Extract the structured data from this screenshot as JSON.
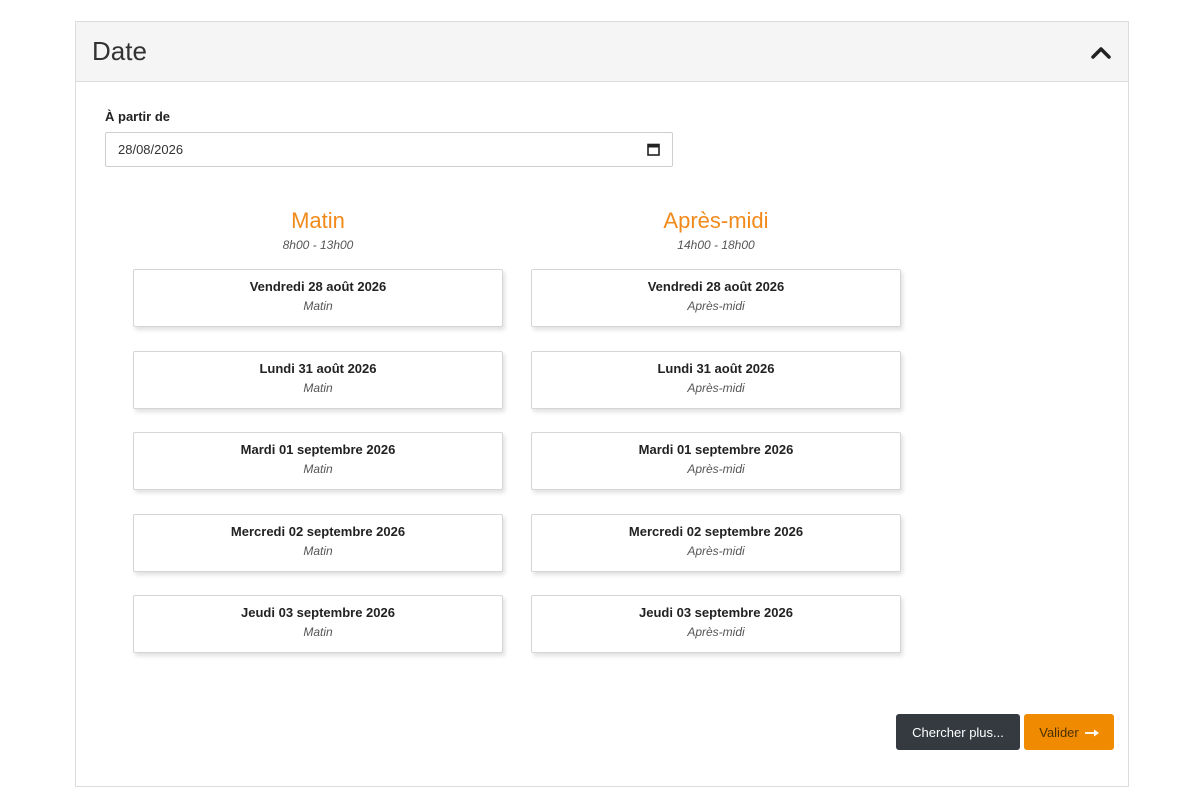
{
  "panel": {
    "title": "Date",
    "collapse_icon": "chevron-up-icon"
  },
  "start": {
    "label": "À partir de",
    "value": "28/08/2026",
    "icon": "calendar-icon"
  },
  "columns": [
    {
      "title": "Matin",
      "hours": "8h00 - 13h00",
      "slots": [
        {
          "date": "Vendredi 28 août 2026",
          "period": "Matin"
        },
        {
          "date": "Lundi 31 août 2026",
          "period": "Matin"
        },
        {
          "date": "Mardi 01 septembre 2026",
          "period": "Matin"
        },
        {
          "date": "Mercredi 02 septembre 2026",
          "period": "Matin"
        },
        {
          "date": "Jeudi 03 septembre 2026",
          "period": "Matin"
        }
      ]
    },
    {
      "title": "Après-midi",
      "hours": "14h00 - 18h00",
      "slots": [
        {
          "date": "Vendredi 28 août 2026",
          "period": "Après-midi"
        },
        {
          "date": "Lundi 31 août 2026",
          "period": "Après-midi"
        },
        {
          "date": "Mardi 01 septembre 2026",
          "period": "Après-midi"
        },
        {
          "date": "Mercredi 02 septembre 2026",
          "period": "Après-midi"
        },
        {
          "date": "Jeudi 03 septembre 2026",
          "period": "Après-midi"
        }
      ]
    }
  ],
  "actions": {
    "more_label": "Chercher plus...",
    "validate_label": "Valider",
    "validate_icon": "arrow-right-icon"
  },
  "colors": {
    "accent": "#f28a1b",
    "button_orange": "#f08a00",
    "button_dark": "#343a40"
  }
}
